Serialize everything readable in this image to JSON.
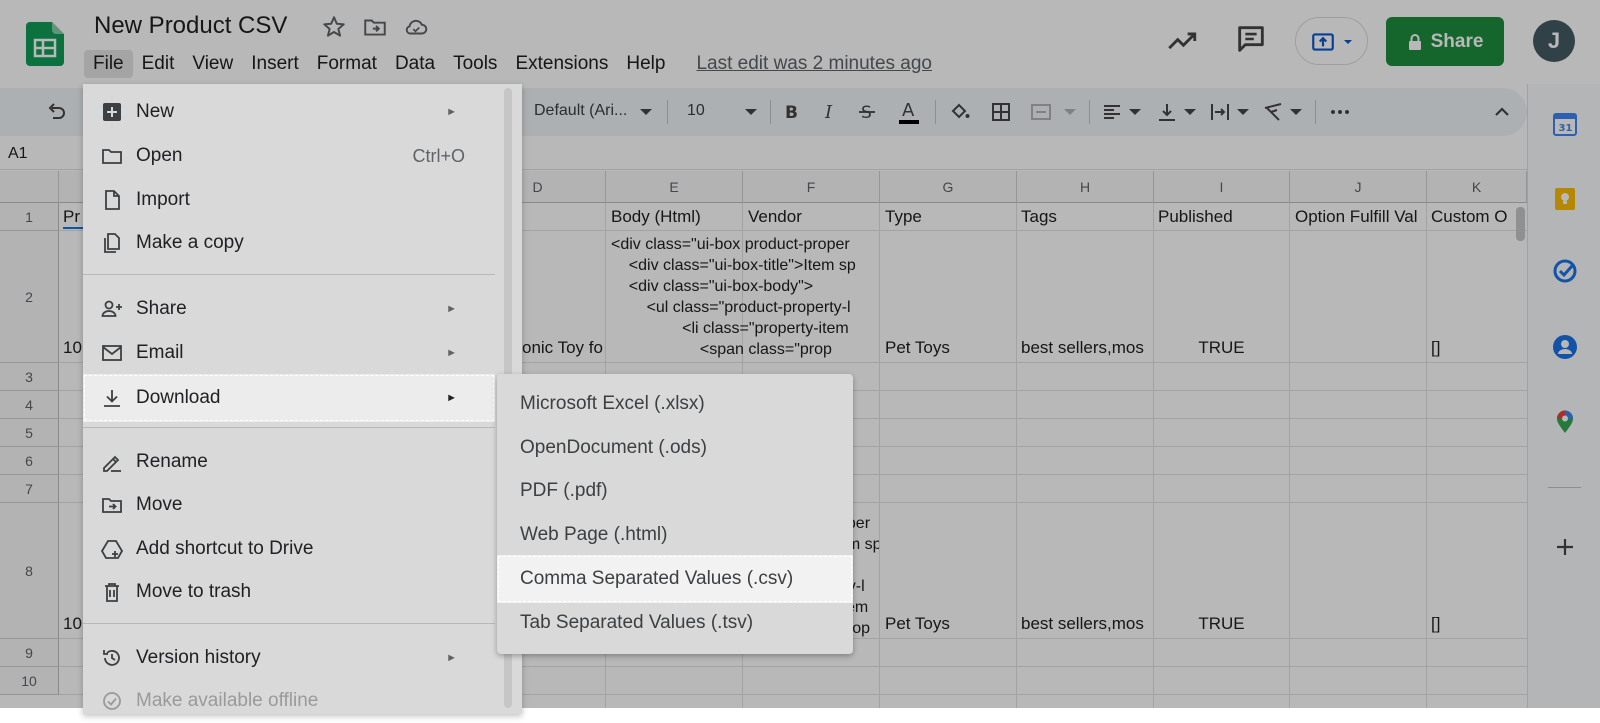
{
  "doc": {
    "title": "New Product CSV",
    "last_edit": "Last edit was 2 minutes ago"
  },
  "menubar": [
    "File",
    "Edit",
    "View",
    "Insert",
    "Format",
    "Data",
    "Tools",
    "Extensions",
    "Help"
  ],
  "header": {
    "share_label": "Share",
    "avatar_initial": "J"
  },
  "toolbar": {
    "font": "Default (Ari...",
    "font_size": "10"
  },
  "formula_bar": {
    "name_box": "A1"
  },
  "grid": {
    "columns": [
      "D",
      "E",
      "F",
      "G",
      "H",
      "I",
      "J",
      "K"
    ],
    "rows": [
      "1",
      "2",
      "3",
      "4",
      "5",
      "6",
      "7",
      "8",
      "9",
      "10"
    ],
    "row1": {
      "a": "Pr",
      "e": "Body (Html)",
      "f": "Vendor",
      "g": "Type",
      "h": "Tags",
      "i": "Published",
      "j": "Option Fulfill Val",
      "k": "Custom O"
    },
    "row2": {
      "a": "10",
      "d": "onic Toy fo",
      "e_lines": [
        "<div class=\"ui-box product-proper",
        "    <div class=\"ui-box-title\">Item sp",
        "    <div class=\"ui-box-body\">",
        "        <ul class=\"product-property-l",
        "                <li class=\"property-item",
        "                    <span class=\"prop"
      ],
      "g": "Pet Toys",
      "h": "best sellers,mos",
      "i": "TRUE",
      "k": "[]"
    },
    "row8": {
      "a": "10",
      "e_lines": [
        "oper",
        "em sp",
        "",
        "rty-l",
        "item",
        "prop"
      ],
      "g": "Pet Toys",
      "h": "best sellers,mos",
      "i": "TRUE",
      "k": "[]"
    }
  },
  "file_menu": {
    "items": [
      {
        "label": "New",
        "icon": "new-sheet-icon",
        "arrow": "►"
      },
      {
        "label": "Open",
        "icon": "folder-icon",
        "shortcut": "Ctrl+O"
      },
      {
        "label": "Import",
        "icon": "file-icon"
      },
      {
        "label": "Make a copy",
        "icon": "copy-icon"
      },
      {
        "label": "Share",
        "icon": "person-add-icon",
        "arrow": "►"
      },
      {
        "label": "Email",
        "icon": "email-icon",
        "arrow": "►"
      },
      {
        "label": "Download",
        "icon": "download-icon",
        "arrow": "►"
      },
      {
        "label": "Rename",
        "icon": "rename-icon"
      },
      {
        "label": "Move",
        "icon": "move-icon"
      },
      {
        "label": "Add shortcut to Drive",
        "icon": "drive-shortcut-icon"
      },
      {
        "label": "Move to trash",
        "icon": "trash-icon"
      },
      {
        "label": "Version history",
        "icon": "history-icon",
        "arrow": "►"
      },
      {
        "label": "Make available offline",
        "icon": "offline-icon"
      }
    ]
  },
  "download_submenu": {
    "items": [
      "Microsoft Excel (.xlsx)",
      "OpenDocument (.ods)",
      "PDF (.pdf)",
      "Web Page (.html)",
      "Comma Separated Values (.csv)",
      "Tab Separated Values (.tsv)"
    ],
    "highlighted": "Comma Separated Values (.csv)"
  },
  "colors": {
    "share_green": "#1e8e3e",
    "sheets_green": "#0f9d58",
    "overlay": "rgba(0,0,0,0.28)"
  }
}
